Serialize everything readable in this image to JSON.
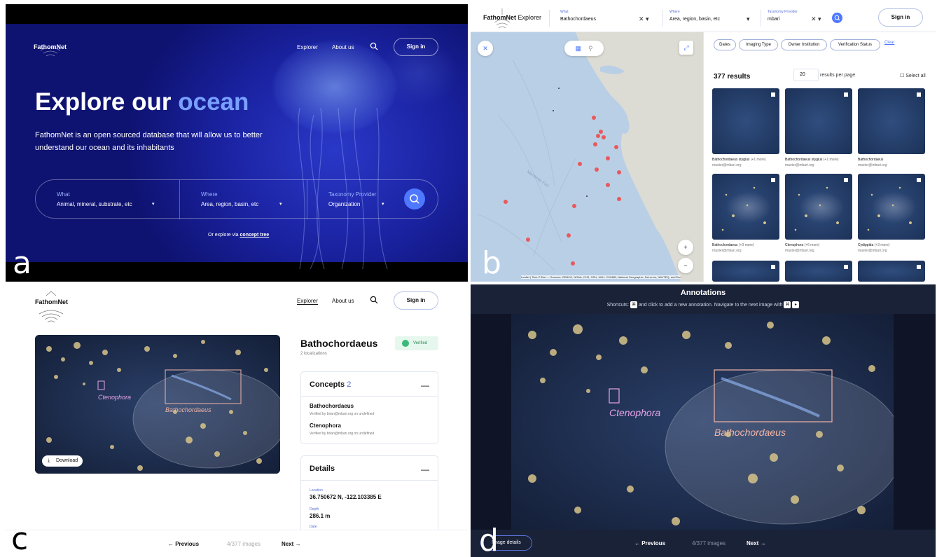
{
  "panel_letters": {
    "a": "a",
    "b": "b",
    "c": "c",
    "d": "d"
  },
  "colors": {
    "accent": "#4e78ff",
    "hero_bg": "#1a22a0",
    "ocean_text": "#7aa0ff",
    "verified": "#3ab97a",
    "box_outline": "#f1b4a6",
    "ctenophora_box": "#e6a4e6"
  },
  "home": {
    "brand": "FathomNet",
    "nav": {
      "explorer": "Explorer",
      "about": "About us",
      "signin": "Sign in"
    },
    "headline_prefix": "Explore our ",
    "headline_accent": "ocean",
    "description": "FathomNet is an open sourced database that will allow us to better understand our ocean and its inhabitants",
    "search": {
      "what_label": "What",
      "what_placeholder": "Animal, mineral, substrate, etc",
      "where_label": "Where",
      "where_placeholder": "Area, region, basin, etc",
      "tax_label": "Taxonomy Provider",
      "tax_placeholder": "Organization"
    },
    "explore_prefix": "Or explore via ",
    "explore_link": "concept tree"
  },
  "explorer": {
    "brand": "FathomNet",
    "brand_suffix": "Explorer",
    "what_label": "What",
    "what_value": "Bathochordaeus",
    "where_label": "Where",
    "where_value": "Area, region, basin, etc",
    "tax_label": "Taxonomy Provider",
    "tax_value": "mbari",
    "clear_glyph": "✕ ▾",
    "caret": "▾",
    "signin": "Sign in",
    "filters": [
      "Dates",
      "Imaging Type",
      "Owner Institution",
      "Verification Status"
    ],
    "clear": "Clear",
    "results_count": "377 results",
    "per_page": "20",
    "per_page_label": "results per page",
    "select_all": "☐ Select all",
    "map_attribution": "Leaflet | Tiles © Esri — Sources: GEBCO, NOAA, CHS, OSU, UNH, CSUMB, National Geographic, DeLorme, NAVTEQ, and Esri",
    "map_controls": {
      "close": "✕",
      "zoom_in": "+",
      "zoom_out": "−",
      "expand": "⤢"
    },
    "thumbnails": [
      {
        "name": "Bathochordaeus stygius",
        "more": " (+1 more)",
        "owner": "master@mbari.org"
      },
      {
        "name": "Bathochordaeus stygius",
        "more": " (+1 more)",
        "owner": "master@mbari.org"
      },
      {
        "name": "Bathochordaeus",
        "more": "",
        "owner": "master@mbari.org"
      },
      {
        "name": "Bathochordaeus",
        "more": " (+3 more)",
        "owner": "master@mbari.org"
      },
      {
        "name": "Ctenophora",
        "more": " (+6 more)",
        "owner": "master@mbari.org"
      },
      {
        "name": "Cydippida",
        "more": " (+3 more)",
        "owner": "master@mbari.org"
      }
    ]
  },
  "detail": {
    "brand": "FathomNet",
    "nav": {
      "explorer": "Explorer",
      "about": "About us",
      "signin": "Sign in"
    },
    "download": "Download",
    "title": "Bathochordaeus",
    "localizations": "2 localizations",
    "verified": "Verified",
    "concepts_heading": "Concepts",
    "concepts_count": "2",
    "concepts": [
      {
        "name": "Bathochordaeus",
        "verified_by": "Verified by brian@mbari.org on undefined"
      },
      {
        "name": "Ctenophora",
        "verified_by": "Verified by brian@mbari.org on undefined"
      }
    ],
    "details_heading": "Details",
    "location_label": "Location",
    "location_value": "36.750672 N, -122.103385 E",
    "depth_label": "Depth",
    "depth_value": "286.1 m",
    "date_label": "Date",
    "box_labels": {
      "ctenophora": "Ctenophora",
      "bathochordaeus": "Bathochordaeus"
    },
    "pager": {
      "previous": "← Previous",
      "count": "4/377 images",
      "next": "Next →"
    }
  },
  "annotations": {
    "title": "Annotations",
    "shortcuts_prefix": "Shortcuts:",
    "shortcuts_mid": "and click to add a new annotation. Navigate to the next image with",
    "key1": "⌘",
    "key2": "⌘",
    "key3": "▸",
    "image_details": "Image details",
    "box_labels": {
      "ctenophora": "Ctenophora",
      "bathochordaeus": "Bathochordaeus"
    },
    "pager": {
      "previous": "← Previous",
      "count": "4/377 images",
      "next": "Next →"
    }
  }
}
